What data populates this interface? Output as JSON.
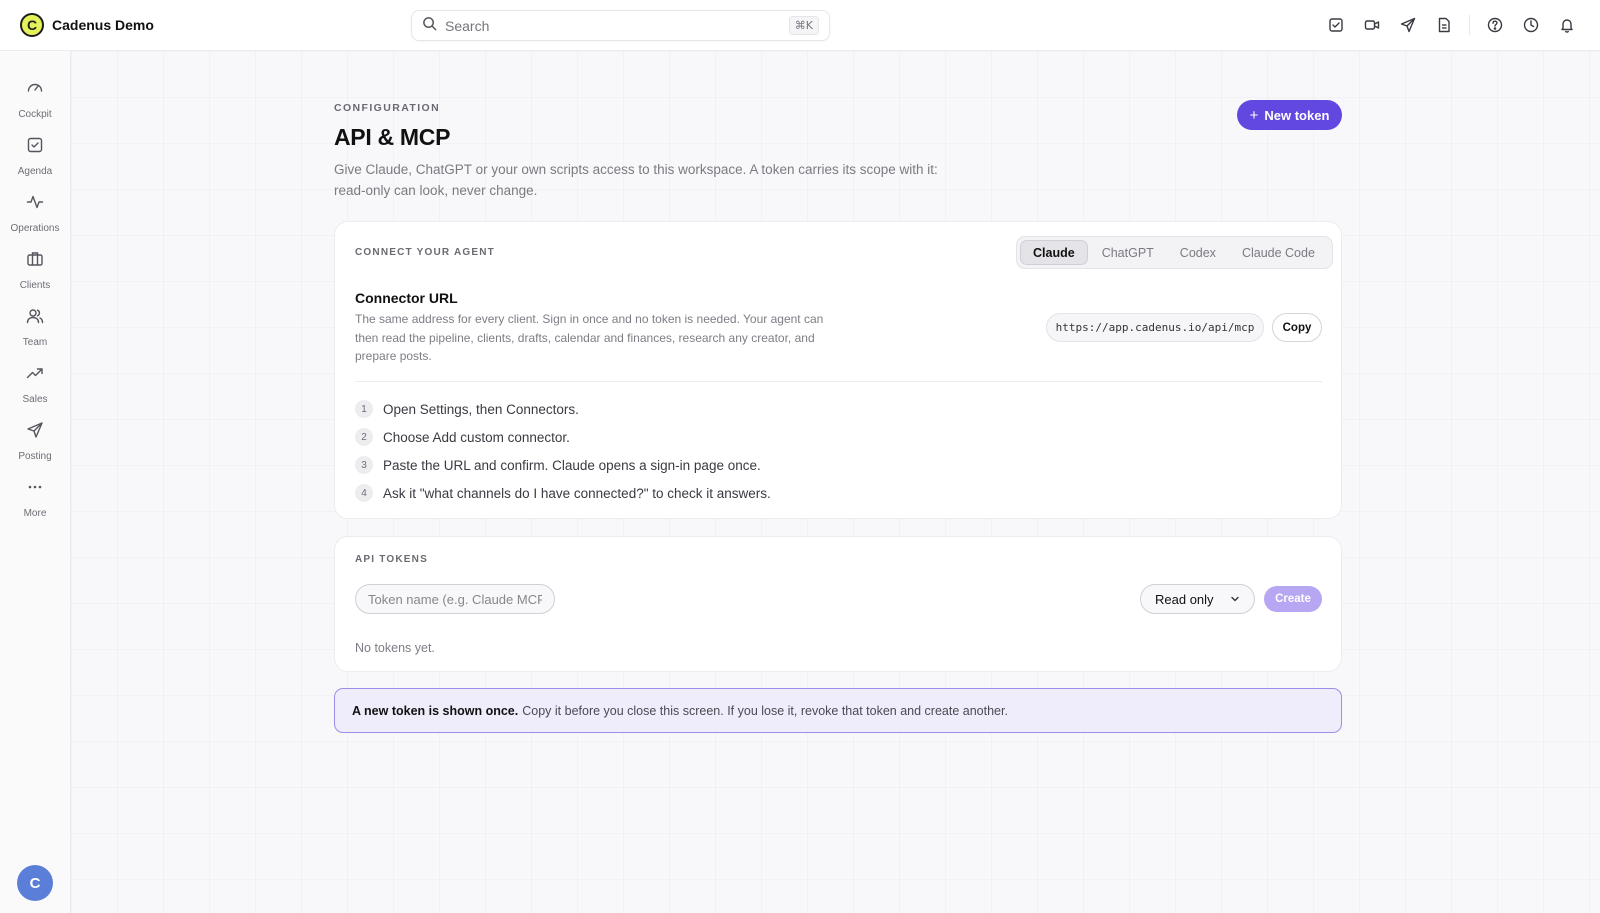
{
  "brand": {
    "name": "Cadenus Demo",
    "logo_letter": "C"
  },
  "search": {
    "placeholder": "Search",
    "shortcut": "⌘K"
  },
  "top_icons": [
    "tasks-icon",
    "video-icon",
    "send-icon",
    "document-icon",
    "help-icon",
    "clock-icon",
    "bell-icon"
  ],
  "sidebar": {
    "items": [
      {
        "label": "Cockpit",
        "icon": "gauge-icon"
      },
      {
        "label": "Agenda",
        "icon": "checkbox-icon"
      },
      {
        "label": "Operations",
        "icon": "activity-icon"
      },
      {
        "label": "Clients",
        "icon": "briefcase-icon"
      },
      {
        "label": "Team",
        "icon": "users-icon"
      },
      {
        "label": "Sales",
        "icon": "trending-up-icon"
      },
      {
        "label": "Posting",
        "icon": "send-icon"
      },
      {
        "label": "More",
        "icon": "ellipsis-icon"
      }
    ],
    "avatar_letter": "C"
  },
  "header": {
    "eyebrow": "CONFIGURATION",
    "title": "API & MCP",
    "description": "Give Claude, ChatGPT or your own scripts access to this workspace. A token carries its scope with it: read-only can look, never change.",
    "new_token_label": "New token"
  },
  "connect": {
    "eyebrow": "CONNECT YOUR AGENT",
    "tabs": [
      {
        "label": "Claude",
        "active": true
      },
      {
        "label": "ChatGPT",
        "active": false
      },
      {
        "label": "Codex",
        "active": false
      },
      {
        "label": "Claude Code",
        "active": false
      }
    ],
    "connector_title": "Connector URL",
    "connector_desc": "The same address for every client. Sign in once and no token is needed. Your agent can then read the pipeline, clients, drafts, calendar and finances, research any creator, and prepare posts.",
    "url": "https://app.cadenus.io/api/mcp",
    "copy_label": "Copy",
    "steps": [
      {
        "num": "1",
        "text": "Open Settings, then Connectors."
      },
      {
        "num": "2",
        "text": "Choose Add custom connector."
      },
      {
        "num": "3",
        "text": "Paste the URL and confirm. Claude opens a sign-in page once."
      },
      {
        "num": "4",
        "text": "Ask it \"what channels do I have connected?\" to check it answers."
      }
    ]
  },
  "tokens": {
    "eyebrow": "API TOKENS",
    "name_placeholder": "Token name (e.g. Claude MCP)",
    "scope_value": "Read only",
    "create_label": "Create",
    "empty_text": "No tokens yet."
  },
  "notice": {
    "bold": "A new token is shown once.",
    "text": "Copy it before you close this screen. If you lose it, revoke that token and create another."
  },
  "colors": {
    "accent": "#6247e0",
    "accent_soft": "#b7a6f2",
    "notice_bg": "#efedfb"
  }
}
